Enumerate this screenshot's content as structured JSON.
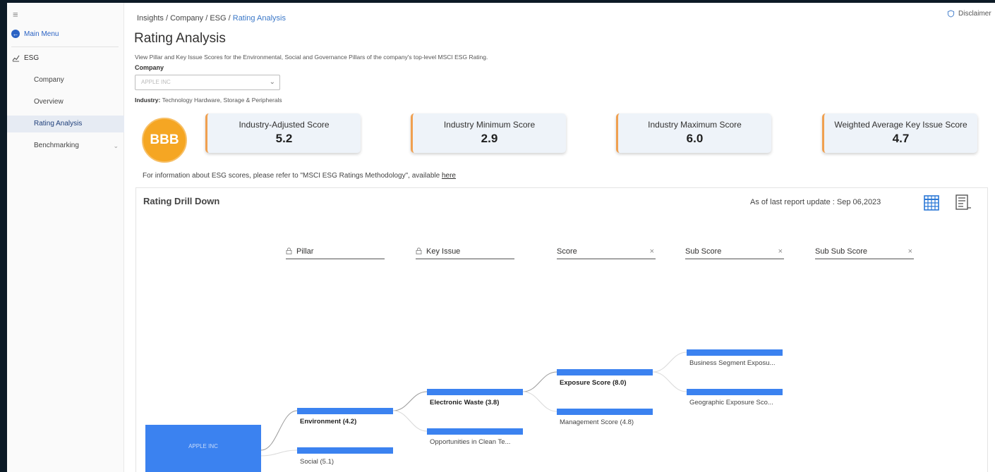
{
  "sidebar": {
    "main_menu": "Main Menu",
    "section": "ESG",
    "items": [
      {
        "label": "Company"
      },
      {
        "label": "Overview"
      },
      {
        "label": "Rating Analysis"
      },
      {
        "label": "Benchmarking"
      }
    ]
  },
  "header": {
    "breadcrumb": [
      "Insights",
      "Company",
      "ESG",
      "Rating Analysis"
    ],
    "disclaimer": "Disclaimer",
    "title": "Rating Analysis",
    "description": "View Pillar and Key Issue Scores for the Environmental, Social and Governance Pillars of the company's top-level MSCI ESG Rating.",
    "company_label": "Company",
    "company_value": "APPLE INC",
    "industry_label": "Industry:",
    "industry_value": "Technology Hardware, Storage & Peripherals"
  },
  "rating": {
    "letter": "BBB",
    "color": "#f5a623"
  },
  "scores": [
    {
      "label": "Industry-Adjusted Score",
      "value": "5.2"
    },
    {
      "label": "Industry Minimum Score",
      "value": "2.9"
    },
    {
      "label": "Industry Maximum Score",
      "value": "6.0"
    },
    {
      "label": "Weighted Average Key Issue Score",
      "value": "4.7"
    }
  ],
  "info": {
    "text": "For information about ESG scores, please refer to \"MSCI ESG Ratings Methodology\", available",
    "link": "here"
  },
  "drill": {
    "title": "Rating Drill Down",
    "as_of": "As of last report update :  Sep 06,2023",
    "columns": [
      {
        "label": "Pillar",
        "locked": true
      },
      {
        "label": "Key Issue",
        "locked": true
      },
      {
        "label": "Score",
        "removable": true
      },
      {
        "label": "Sub Score",
        "removable": true
      },
      {
        "label": "Sub Sub Score",
        "removable": true
      }
    ],
    "root": "APPLE INC",
    "pillar_nodes": [
      "Environment (4.2)",
      "Social (5.1)"
    ],
    "key_issue_nodes": [
      "Electronic Waste (3.8)",
      "Opportunities in Clean Te..."
    ],
    "score_nodes": [
      "Exposure Score (8.0)",
      "Management Score (4.8)"
    ],
    "sub_score_nodes": [
      "Business Segment Exposu...",
      "Geographic Exposure Sco..."
    ],
    "bar_color": "#3b82f0"
  }
}
